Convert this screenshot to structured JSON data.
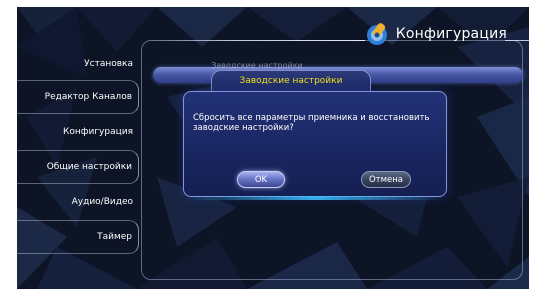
{
  "header": {
    "title": "Конфигурация",
    "icon": "wrench-settings-icon"
  },
  "sidebar": {
    "items": [
      {
        "label": "Установка"
      },
      {
        "label": "Редактор Каналов"
      },
      {
        "label": "Конфигурация"
      },
      {
        "label": "Общие настройки"
      },
      {
        "label": "Аудио/Видео"
      },
      {
        "label": "Таймер"
      }
    ]
  },
  "background_row": {
    "label": "Заводские настройки"
  },
  "dialog": {
    "title": "Заводские настройки",
    "message": "Сбросить все параметры приемника и восстановить заводские настройки?",
    "ok_label": "OK",
    "cancel_label": "Отмена"
  },
  "colors": {
    "dialog_title": "#e8e020",
    "background": "#0c1426",
    "dialog_bg": "#1b2764",
    "accent_glow": "#3cbeff"
  }
}
